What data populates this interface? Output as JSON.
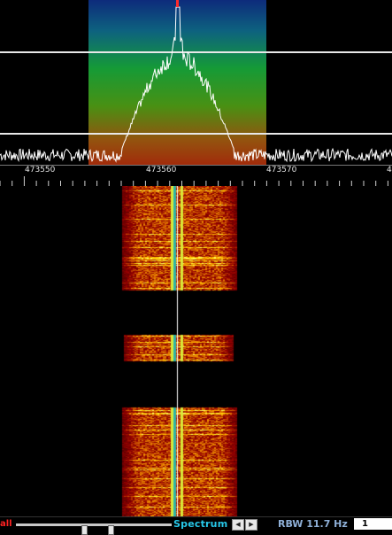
{
  "spectrum": {
    "tick_labels": [
      "473550",
      "473560",
      "473570",
      "4"
    ],
    "colors": {
      "trace": "#ffffff",
      "level_lines": "#e8e8e8",
      "center_marker": "#ff2a2a",
      "passband_top": "#0e2f86",
      "passband_bottom": "#b3240a"
    }
  },
  "statusbar": {
    "mode_label": "all",
    "view_label": "Spectrum",
    "arrow_left_icon": "triangle-left",
    "arrow_right_icon": "triangle-right",
    "rbw_label": "RBW 11.7 Hz",
    "averaging_value": "1",
    "colors": {
      "mode": "#ff2222",
      "view": "#27c7e8",
      "rbw": "#8fb0d8"
    }
  }
}
